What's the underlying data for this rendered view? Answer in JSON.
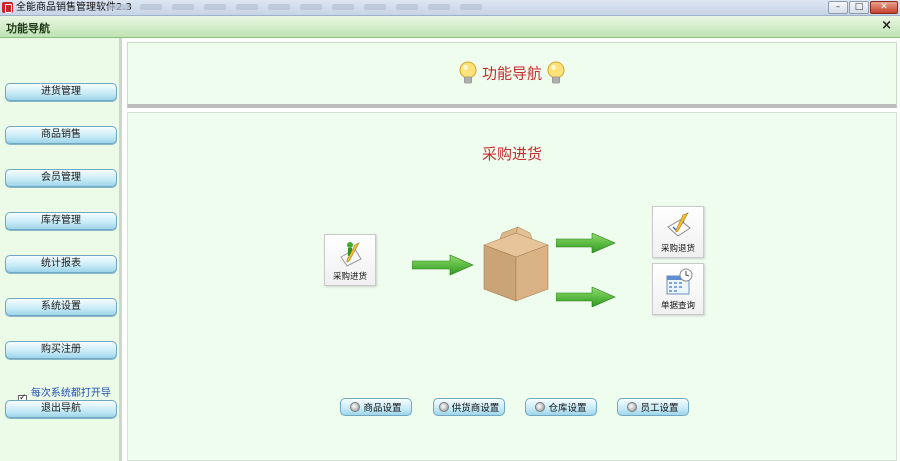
{
  "window": {
    "title": "全能商品销售管理软件2.3",
    "minimize": "–",
    "maximize": "□",
    "close": "✕"
  },
  "panel": {
    "title": "功能导航",
    "close": "×"
  },
  "sidebar": {
    "items": [
      {
        "label": "进货管理"
      },
      {
        "label": "商品销售"
      },
      {
        "label": "会员管理"
      },
      {
        "label": "库存管理"
      },
      {
        "label": "统计报表"
      },
      {
        "label": "系统设置"
      },
      {
        "label": "购买注册"
      }
    ],
    "startup_checkbox": {
      "label": "每次系统都打开导航",
      "checked": true
    },
    "exit_label": "退出导航"
  },
  "main": {
    "header_title": "功能导航",
    "section_title": "采购进货",
    "tiles": {
      "purchase": "采购进货",
      "purchase_return": "采购退货",
      "bill_query": "单据查询"
    },
    "bottom_buttons": [
      {
        "label": "商品设置"
      },
      {
        "label": "供货商设置"
      },
      {
        "label": "仓库设置"
      },
      {
        "label": "员工设置"
      }
    ]
  },
  "colors": {
    "accent_red": "#c62d2d",
    "panel_green": "#eefdee",
    "button_blue": "#9fd4ea",
    "arrow_green": "#2e9a1e"
  },
  "icons": [
    "app-icon",
    "bulb-icon",
    "pencil-document-icon",
    "checklist-icon",
    "calendar-clock-icon",
    "cardboard-box-icon",
    "green-arrow-icon",
    "gear-icon"
  ]
}
